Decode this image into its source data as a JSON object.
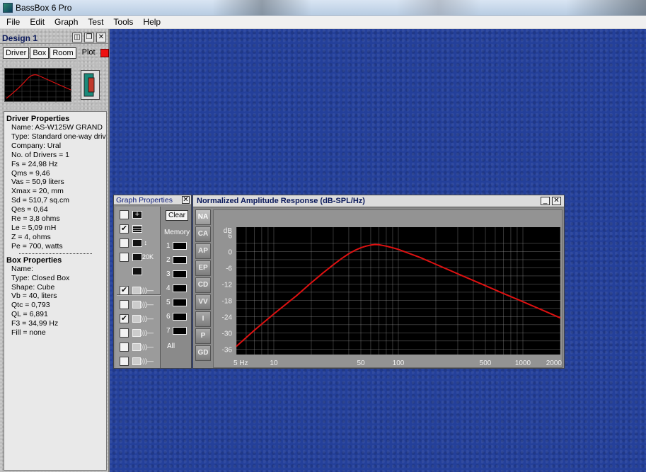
{
  "app": {
    "title": "BassBox 6 Pro"
  },
  "menu": {
    "items": [
      "File",
      "Edit",
      "Graph",
      "Test",
      "Tools",
      "Help"
    ]
  },
  "design": {
    "title": "Design 1",
    "tabs": [
      "Driver",
      "Box",
      "Room",
      "Plot"
    ],
    "driver_section": "Driver Properties",
    "driver_rows": [
      "Name: AS-W125W GRAND",
      "Type: Standard one-way driv",
      "Company: Ural",
      "No. of Drivers = 1",
      "Fs =  24,98 Hz",
      "Qms =  9,46",
      "Vas =  50,9 liters",
      "Xmax =  20, mm",
      "Sd =  510,7 sq.cm",
      "Qes =  0,64",
      "Re =  3,8 ohms",
      "Le =  5,09 mH",
      "Z =  4, ohms",
      "Pe =  700, watts"
    ],
    "box_section": "Box Properties",
    "box_rows": [
      "Name:",
      "Type: Closed Box",
      "Shape: Cube",
      "Vb =  40, liters",
      "Qtc =  0,793",
      "QL =  6,891",
      "F3 =  34,99 Hz",
      "Fill = none"
    ]
  },
  "graph_props": {
    "title": "Graph Properties",
    "clear_label": "Clear",
    "memory_label": "Memory",
    "memory_slots": [
      "1",
      "2",
      "3",
      "4",
      "5",
      "6",
      "7"
    ],
    "all_label": "All",
    "toggle_checked": [
      false,
      true,
      false,
      false,
      true,
      false,
      true,
      false,
      false,
      false
    ],
    "toggle_icons": [
      "plus-icon",
      "grid-icon",
      "vertical-scale-icon",
      "frequency-range-icon",
      "driver-icon",
      "box-icon",
      "room-icon",
      "crossover-icon",
      "speaker-power-icon",
      "driver-box-icon"
    ],
    "range_label": "20K"
  },
  "graph_window": {
    "title": "Normalized Amplitude Response (dB-SPL/Hz)",
    "side_tabs": [
      "NA",
      "CA",
      "AP",
      "EP",
      "CD",
      "VV",
      "I",
      "P",
      "GD"
    ],
    "active_tab": "NA"
  },
  "chart_data": {
    "type": "line",
    "title": "Normalized Amplitude Response (dB-SPL/Hz)",
    "ylabel": "dB",
    "xlabel": "",
    "x_scale": "log",
    "xlim": [
      5,
      2000
    ],
    "ylim": [
      -38,
      9
    ],
    "y_ticks": [
      6,
      0,
      -6,
      -12,
      -18,
      -24,
      -30,
      -36
    ],
    "x_ticks": [
      5,
      10,
      50,
      100,
      500,
      1000,
      2000
    ],
    "x_tick_labels": [
      "5 Hz",
      "10",
      "50",
      "100",
      "500",
      "1000",
      "2000"
    ],
    "grid": true,
    "colors": {
      "background": "#000000",
      "grid": "#9a9a9a",
      "curve": "#dd1111"
    },
    "series": [
      {
        "x": [
          5,
          7,
          10,
          15,
          20,
          25,
          30,
          35,
          40,
          45,
          50,
          55,
          60,
          65,
          70,
          80,
          90,
          100,
          150,
          200,
          300,
          500,
          700,
          1000,
          1500,
          2000
        ],
        "y": [
          -35,
          -29,
          -23,
          -16.5,
          -11.5,
          -7.8,
          -4.9,
          -2.6,
          -0.8,
          0.5,
          1.4,
          2.0,
          2.4,
          2.6,
          2.5,
          2.0,
          1.4,
          0.8,
          -2.2,
          -4.7,
          -8.2,
          -12.6,
          -15.5,
          -18.5,
          -22.0,
          -24.5
        ]
      }
    ]
  }
}
